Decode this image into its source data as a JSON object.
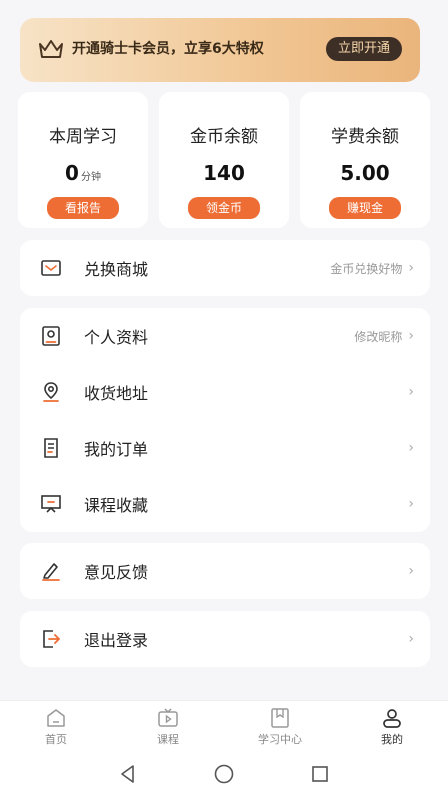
{
  "banner": {
    "text": "开通骑士卡会员，立享6大特权",
    "button": "立即开通"
  },
  "stats": [
    {
      "label": "本周学习",
      "value": "0",
      "unit": "分钟",
      "action": "看报告"
    },
    {
      "label": "金币余额",
      "value": "140",
      "unit": "",
      "action": "领金币"
    },
    {
      "label": "学费余额",
      "value": "5.00",
      "unit": "",
      "action": "赚现金"
    }
  ],
  "menu": {
    "shop": {
      "title": "兑换商城",
      "hint": "金币兑换好物"
    },
    "profile": {
      "title": "个人资料",
      "hint": "修改昵称"
    },
    "address": {
      "title": "收货地址"
    },
    "orders": {
      "title": "我的订单"
    },
    "favorites": {
      "title": "课程收藏"
    },
    "feedback": {
      "title": "意见反馈"
    },
    "logout": {
      "title": "退出登录"
    },
    "chevron": "›"
  },
  "tabs": [
    {
      "label": "首页",
      "icon": "home-icon"
    },
    {
      "label": "课程",
      "icon": "tv-icon"
    },
    {
      "label": "学习中心",
      "icon": "bookmark-icon"
    },
    {
      "label": "我的",
      "icon": "profile-icon"
    }
  ],
  "colors": {
    "accent": "#ee6d35",
    "banner_dark": "#3d2f25",
    "background": "#f6f6f8"
  }
}
